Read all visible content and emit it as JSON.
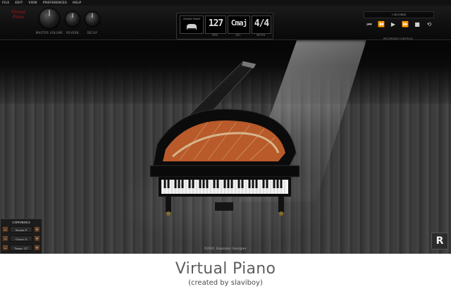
{
  "menu": [
    "FILE",
    "EDIT",
    "VIEW",
    "PREFERENCES",
    "HELP"
  ],
  "logo": {
    "line1": "Virtual",
    "line2": "Piano"
  },
  "knobs": [
    {
      "name": "master-volume-knob",
      "label": "MASTER VOLUME"
    },
    {
      "name": "reverb-knob",
      "label": "REVERB"
    },
    {
      "name": "decay-knob",
      "label": "DECAY"
    }
  ],
  "display": {
    "instrument": "GRAND PIANO",
    "bpm": {
      "value": "127",
      "label": "BPM"
    },
    "key": {
      "value": "Cmaj",
      "label": "KEY"
    },
    "meter": {
      "value": "4/4",
      "label": "METER"
    }
  },
  "transport": {
    "record_display": "1 SECONDS",
    "label": "RECORDING CONTROLS",
    "buttons": [
      "⏮",
      "⏪",
      "▶",
      "⏩",
      "■",
      "⟲"
    ]
  },
  "controls": {
    "title": "CONTROLS",
    "rows": [
      {
        "label": "Sustain: 0",
        "minus": "−",
        "plus": "+"
      },
      {
        "label": "Octave: 0",
        "minus": "−",
        "plus": "+"
      },
      {
        "label": "Tempo: 127",
        "minus": "−",
        "plus": "+"
      }
    ]
  },
  "copyright": "©2021 Stanislav Georgiev",
  "corner_logo": "R",
  "caption": {
    "title": "Virtual Piano",
    "subtitle": "(created by slaviboy)"
  },
  "colors": {
    "logo": "#7d1616",
    "wood": "#3d3d3d",
    "piano_body": "#0b0b0b",
    "strings": "#b85a2a"
  }
}
